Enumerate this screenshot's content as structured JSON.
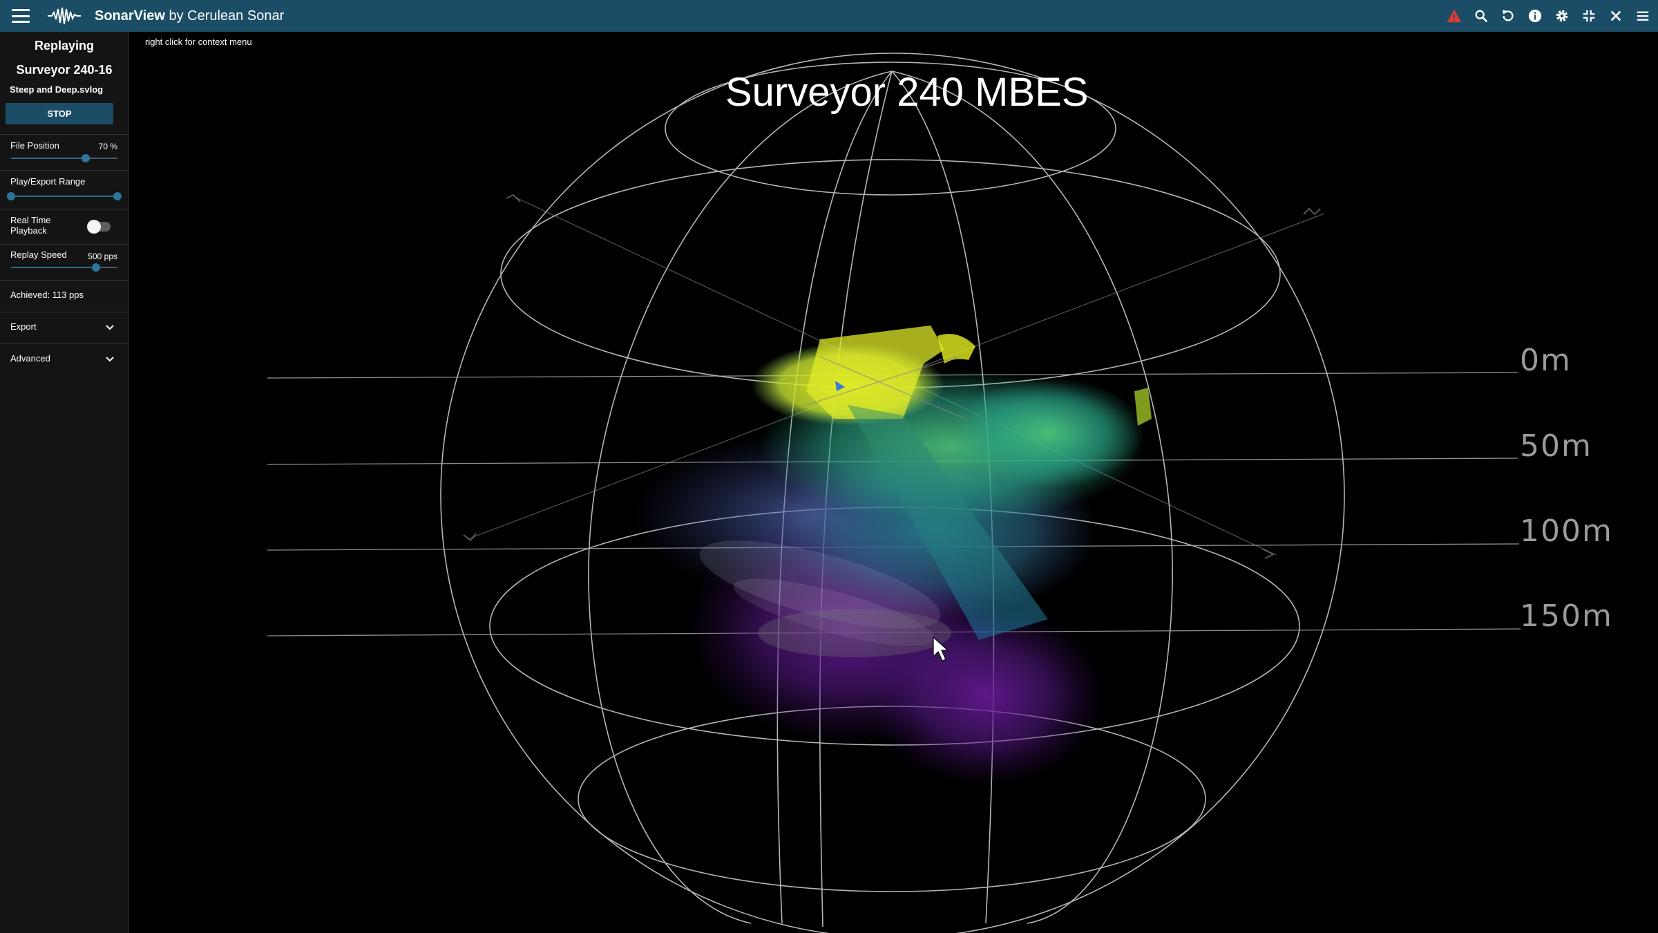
{
  "app": {
    "title_bold": "SonarView",
    "title_rest": " by Cerulean Sonar"
  },
  "toolbar_icons": [
    "warning-icon",
    "search-icon",
    "refresh-icon",
    "info-icon",
    "gear-icon",
    "fullscreen-exit-icon",
    "close-icon",
    "menu-icon"
  ],
  "colors": {
    "topbar": "#1c4d66",
    "accent": "#2d7599",
    "warning": "#e53935"
  },
  "sidebar": {
    "status": "Replaying",
    "device": "Surveyor 240-16",
    "file": "Steep and Deep.svlog",
    "stop_label": "STOP",
    "file_position": {
      "label": "File Position",
      "value_text": "70 %",
      "value": 70
    },
    "play_range": {
      "label": "Play/Export Range",
      "start": 0,
      "end": 100
    },
    "realtime": {
      "label_line1": "Real Time",
      "label_line2": "Playback",
      "on": false
    },
    "replay_speed": {
      "label": "Replay Speed",
      "value_text": "500 pps",
      "value": 80
    },
    "achieved": "Achieved: 113 pps",
    "export_label": "Export",
    "advanced_label": "Advanced"
  },
  "view": {
    "hint": "right click for context menu",
    "title": "Surveyor 240 MBES",
    "depth_labels": [
      "0m",
      "50m",
      "100m",
      "150m"
    ]
  }
}
